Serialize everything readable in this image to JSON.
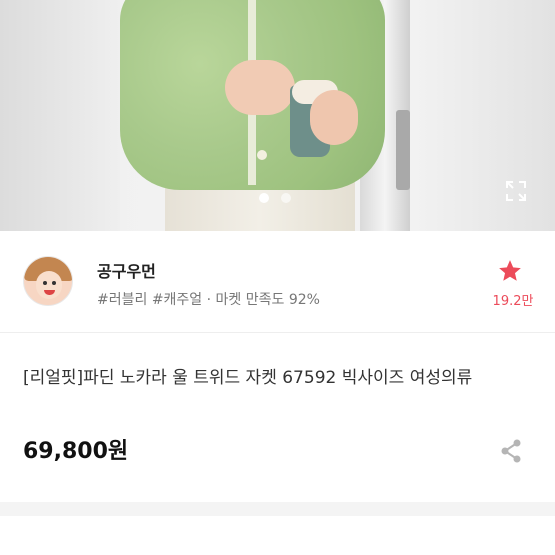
{
  "gallery": {
    "current_index": 1,
    "total_images": 2
  },
  "seller": {
    "name": "공구우먼",
    "tags": "#러블리 #캐주얼 · 마켓 만족도 92%",
    "favorite_count": "19.2만"
  },
  "product": {
    "title": "[리얼핏]파딘 노카라 울 트위드 자켓 67592 빅사이즈 여성의류",
    "price": "69,800원"
  },
  "colors": {
    "accent": "#ec4b5a",
    "text_primary": "#222222",
    "text_secondary": "#777777"
  },
  "icons": {
    "expand": "expand-icon",
    "favorite": "star-icon",
    "share": "share-icon"
  }
}
